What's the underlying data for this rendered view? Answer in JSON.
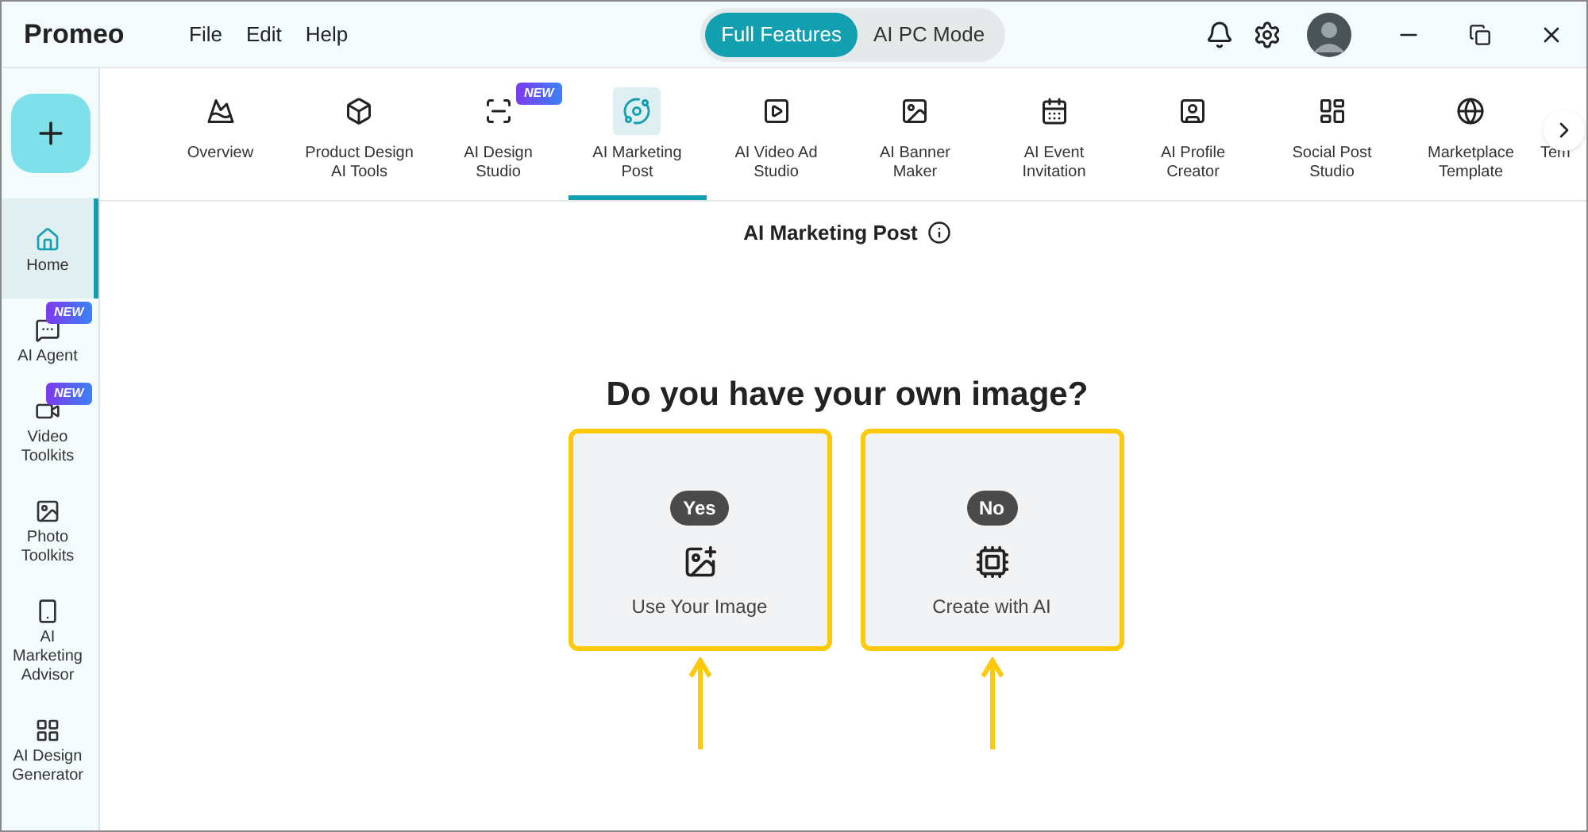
{
  "app": {
    "title": "Promeo"
  },
  "menu": [
    "File",
    "Edit",
    "Help"
  ],
  "modes": [
    {
      "label": "Full Features",
      "selected": true
    },
    {
      "label": "AI PC Mode",
      "selected": false
    }
  ],
  "sidebar": {
    "items": [
      {
        "label": "Home",
        "selected": true
      },
      {
        "label": "AI Agent",
        "selected": false,
        "badge": "NEW"
      },
      {
        "label": "Video Toolkits",
        "selected": false,
        "badge": "NEW"
      },
      {
        "label": "Photo Toolkits",
        "selected": false
      },
      {
        "label": "AI Marketing Advisor",
        "selected": false
      },
      {
        "label": "AI Design Generator",
        "selected": false
      }
    ]
  },
  "tabs": [
    {
      "label": "Overview",
      "selected": false
    },
    {
      "label": "Product Design AI Tools",
      "selected": false
    },
    {
      "label": "AI Design Studio",
      "selected": false,
      "badge": "NEW"
    },
    {
      "label": "AI Marketing Post",
      "selected": true
    },
    {
      "label": "AI Video Ad Studio",
      "selected": false
    },
    {
      "label": "AI Banner Maker",
      "selected": false
    },
    {
      "label": "AI Event Invitation",
      "selected": false
    },
    {
      "label": "AI Profile Creator",
      "selected": false
    },
    {
      "label": "Social Post Studio",
      "selected": false
    },
    {
      "label": "Marketplace Template",
      "selected": false
    },
    {
      "label": "Tem",
      "selected": false
    }
  ],
  "page": {
    "title": "AI Marketing Post",
    "question": "Do you have your own image?",
    "options": [
      {
        "tag": "Yes",
        "label": "Use Your Image",
        "highlighted": true
      },
      {
        "tag": "No",
        "label": "Create with AI",
        "highlighted": true
      }
    ]
  }
}
